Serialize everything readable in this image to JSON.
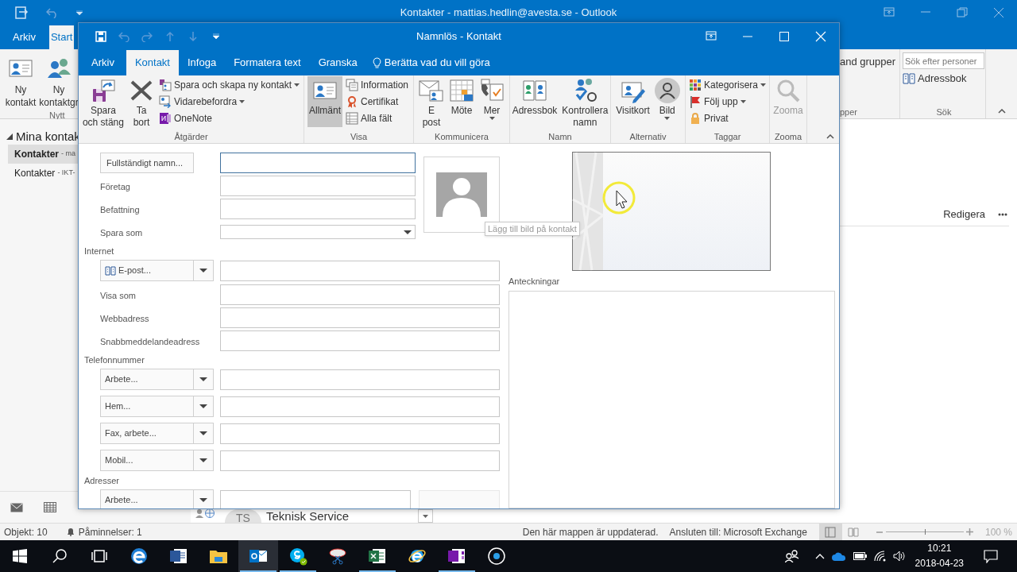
{
  "outlook": {
    "title": "Kontakter - mattias.hedlin@avesta.se - Outlook",
    "tabs": [
      {
        "label": "Arkiv",
        "selected": false
      },
      {
        "label": "Start",
        "selected": true
      }
    ],
    "ribbon_left": {
      "buttons": [
        "Ny\nkontakt",
        "Ny\nkontaktgr"
      ],
      "group_label": "Nytt"
    },
    "ribbon_right": {
      "button": "and grupper",
      "group_label": "pper",
      "search_placeholder": "Sök efter personer",
      "address_book": "Adressbok",
      "search_group_label": "Sök"
    },
    "nav": {
      "header": "Mina kontak",
      "items": [
        {
          "name": "Kontakter",
          "detail": "- ma",
          "selected": true
        },
        {
          "name": "Kontakter",
          "detail": "- IKT-",
          "selected": false
        }
      ]
    },
    "reading_pane": {
      "edit": "Redigera"
    },
    "contact_row": {
      "initials": "TS",
      "name": "Teknisk Service"
    },
    "status_bar": {
      "items": "Objekt: 10",
      "reminders": "Påminnelser: 1",
      "folder_status": "Den här mappen är uppdaterad.",
      "connection": "Ansluten till: Microsoft Exchange",
      "views": [
        {
          "selected": true
        },
        {
          "selected": false
        }
      ],
      "zoom": {
        "level": 0.5,
        "reading": "100 %"
      }
    }
  },
  "dialog": {
    "title": "Namnlös - Kontakt",
    "tabs": [
      {
        "label": "Arkiv",
        "selected": false
      },
      {
        "label": "Kontakt",
        "selected": true
      },
      {
        "label": "Infoga",
        "selected": false
      },
      {
        "label": "Formatera text",
        "selected": false
      },
      {
        "label": "Granska",
        "selected": false
      }
    ],
    "tell_me": "Berätta vad du vill göra",
    "ribbon": [
      {
        "label": "Åtgärder",
        "items": [
          {
            "kind": "large",
            "label": "Spara\noch stäng",
            "dropdown": false
          },
          {
            "kind": "large",
            "label": "Ta\nbort",
            "dropdown": false
          },
          {
            "kind": "small",
            "label": "Spara och skapa ny kontakt",
            "dropdown": true
          },
          {
            "kind": "small",
            "label": "Vidarebefordra",
            "dropdown": true
          },
          {
            "kind": "small",
            "label": "OneNote",
            "dropdown": false
          }
        ]
      },
      {
        "label": "Visa",
        "items": [
          {
            "kind": "large",
            "label": "Allmänt",
            "dropdown": false,
            "selected": true
          },
          {
            "kind": "small",
            "label": "Information",
            "dropdown": false,
            "selected": false
          },
          {
            "kind": "small",
            "label": "Certifikat",
            "dropdown": false,
            "selected": false
          },
          {
            "kind": "small",
            "label": "Alla fält",
            "dropdown": false,
            "selected": false
          }
        ]
      },
      {
        "label": "Kommunicera",
        "items": [
          {
            "kind": "large",
            "label": "E\npost",
            "dropdown": false
          },
          {
            "kind": "large",
            "label": "Möte",
            "dropdown": false
          },
          {
            "kind": "large",
            "label": "Mer",
            "dropdown": true
          }
        ]
      },
      {
        "label": "Namn",
        "items": [
          {
            "kind": "large",
            "label": "Adressbok",
            "dropdown": false
          },
          {
            "kind": "large",
            "label": "Kontrollera\nnamn",
            "dropdown": false
          }
        ]
      },
      {
        "label": "Alternativ",
        "items": [
          {
            "kind": "large",
            "label": "Visitkort",
            "dropdown": false
          },
          {
            "kind": "large",
            "label": "Bild",
            "dropdown": true
          }
        ]
      },
      {
        "label": "Taggar",
        "items": [
          {
            "kind": "small",
            "label": "Kategorisera",
            "dropdown": true
          },
          {
            "kind": "small",
            "label": "Följ upp",
            "dropdown": true
          },
          {
            "kind": "small",
            "label": "Privat",
            "dropdown": false
          }
        ]
      },
      {
        "label": "Zooma",
        "items": [
          {
            "kind": "large",
            "label": "Zooma",
            "dropdown": false,
            "disabled": true
          }
        ]
      }
    ],
    "form": {
      "rows": [
        {
          "kind": "button_field",
          "label": "Fullständigt namn...",
          "focused": true
        },
        {
          "kind": "label_field",
          "label": "Företag",
          "focused": false
        },
        {
          "kind": "label_field",
          "label": "Befattning",
          "focused": false
        },
        {
          "kind": "label_select",
          "label": "Spara som",
          "focused": false
        },
        {
          "kind": "section",
          "label": "Internet"
        },
        {
          "kind": "dropdown_field",
          "label": "E-post...",
          "focused": false
        },
        {
          "kind": "label_field",
          "label": "Visa som",
          "focused": false
        },
        {
          "kind": "label_field",
          "label": "Webbadress",
          "focused": false
        },
        {
          "kind": "label_field",
          "label": "Snabbmeddelandeadress",
          "focused": false
        },
        {
          "kind": "section",
          "label": "Telefonnummer"
        },
        {
          "kind": "dropdown_field",
          "label": "Arbete...",
          "focused": false
        },
        {
          "kind": "dropdown_field",
          "label": "Hem...",
          "focused": false
        },
        {
          "kind": "dropdown_field",
          "label": "Fax, arbete...",
          "focused": false
        },
        {
          "kind": "dropdown_field",
          "label": "Mobil...",
          "focused": false
        },
        {
          "kind": "section",
          "label": "Adresser"
        },
        {
          "kind": "dropdown_field",
          "label": "Arbete...",
          "focused": false
        }
      ],
      "photo_tooltip": "Lägg till bild på kontakt",
      "notes_label": "Anteckningar"
    }
  },
  "taskbar": {
    "apps": [
      {
        "running": false,
        "active": false
      },
      {
        "running": false,
        "active": false
      },
      {
        "running": false,
        "active": false
      },
      {
        "running": true,
        "active": true
      },
      {
        "running": true,
        "active": false
      },
      {
        "running": false,
        "active": false
      },
      {
        "running": true,
        "active": false
      },
      {
        "running": false,
        "active": false
      },
      {
        "running": true,
        "active": false
      },
      {
        "running": false,
        "active": false
      }
    ],
    "clock": {
      "time": "10:21",
      "date": "2018-04-23"
    }
  }
}
